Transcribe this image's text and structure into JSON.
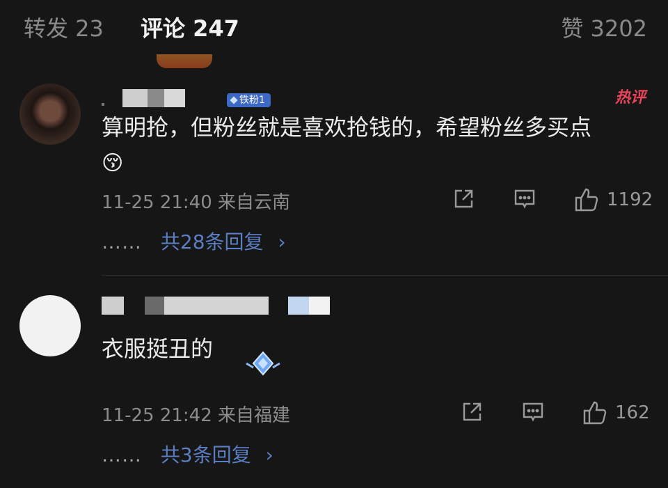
{
  "tabs": {
    "repost": "转发 23",
    "comments": "评论 247",
    "likes": "赞 3202"
  },
  "comments": [
    {
      "badge": "铁粉1",
      "hot_label": "热评",
      "text": "算明抢，但粉丝就是喜欢抢钱的，希望粉丝多买点",
      "emoji": "😚",
      "time": "11-25 21:40",
      "location": "来自云南",
      "likes": "1192",
      "replies_dots": "……",
      "replies_label": "共28条回复",
      "chevron": "›"
    },
    {
      "text": "衣服挺丑的",
      "time": "11-25 21:42",
      "location": "来自福建",
      "likes": "162",
      "replies_dots": "……",
      "replies_label": "共3条回复",
      "chevron": "›"
    }
  ],
  "icons": [
    "share-icon",
    "comment-icon",
    "thumbs-up-icon"
  ]
}
